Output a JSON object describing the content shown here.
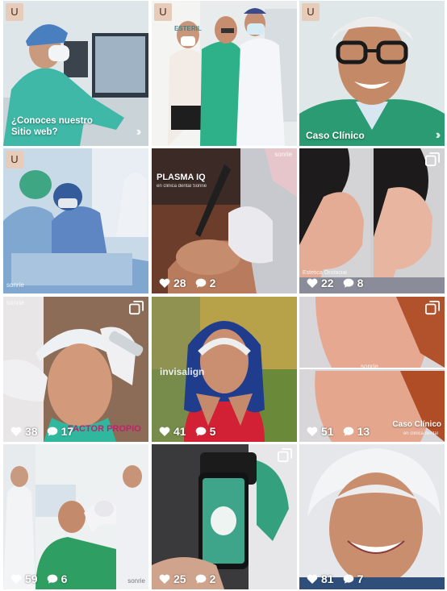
{
  "grid": {
    "tiles": [
      {
        "badge": "U",
        "multi": false,
        "caption": "¿Conoces nuestro\nSitio web?"
      },
      {
        "badge": "U",
        "multi": false,
        "sign": "ESTERIL"
      },
      {
        "badge": "U",
        "multi": false,
        "caption": "Caso Clínico"
      },
      {
        "badge": "U",
        "multi": false,
        "brand": "sonrie"
      },
      {
        "multi": false,
        "likes": "28",
        "comments": "2",
        "title": "PLASMA IQ",
        "subtitle": "en clinica dental Sonrie",
        "brand": "sonrie"
      },
      {
        "multi": true,
        "likes": "22",
        "comments": "8",
        "caption": "Estetica Orofacial"
      },
      {
        "multi": true,
        "likes": "38",
        "comments": "17",
        "caption": "FACTOR PROPIO",
        "brand": "sonrie"
      },
      {
        "multi": false,
        "likes": "41",
        "comments": "5",
        "brand": "invisalign"
      },
      {
        "multi": true,
        "likes": "51",
        "comments": "13",
        "caption": "Caso Clínico",
        "subtitle": "en clinica dental",
        "brand": "sonrie"
      },
      {
        "multi": false,
        "likes": "59",
        "comments": "6",
        "brand": "sonrie"
      },
      {
        "multi": true,
        "likes": "25",
        "comments": "2"
      },
      {
        "multi": true,
        "likes": "81",
        "comments": "7"
      }
    ]
  },
  "icons": {
    "heart": "heart-icon",
    "comment": "comment-icon",
    "multi": "carousel-icon"
  },
  "colors": {
    "scrub_green": "#2aa37c",
    "brand_teal": "#1aa896"
  }
}
